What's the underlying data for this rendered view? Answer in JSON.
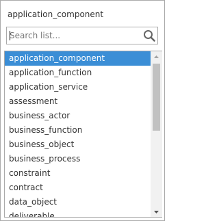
{
  "dropdown": {
    "selected_value": "application_component",
    "search": {
      "value": "",
      "placeholder": "Search list..."
    },
    "items": [
      {
        "label": "application_component",
        "selected": true
      },
      {
        "label": "application_function",
        "selected": false
      },
      {
        "label": "application_service",
        "selected": false
      },
      {
        "label": "assessment",
        "selected": false
      },
      {
        "label": "business_actor",
        "selected": false
      },
      {
        "label": "business_function",
        "selected": false
      },
      {
        "label": "business_object",
        "selected": false
      },
      {
        "label": "business_process",
        "selected": false
      },
      {
        "label": "constraint",
        "selected": false
      },
      {
        "label": "contract",
        "selected": false
      },
      {
        "label": "data_object",
        "selected": false
      },
      {
        "label": "deliverable",
        "selected": false
      }
    ],
    "icons": {
      "search": "search-icon",
      "scroll_up": "chevron-up-icon",
      "scroll_down": "chevron-down-icon"
    },
    "colors": {
      "selected_bg": "#3b8ed6",
      "selected_text": "#ffffff",
      "border": "#aaaaaa"
    }
  }
}
